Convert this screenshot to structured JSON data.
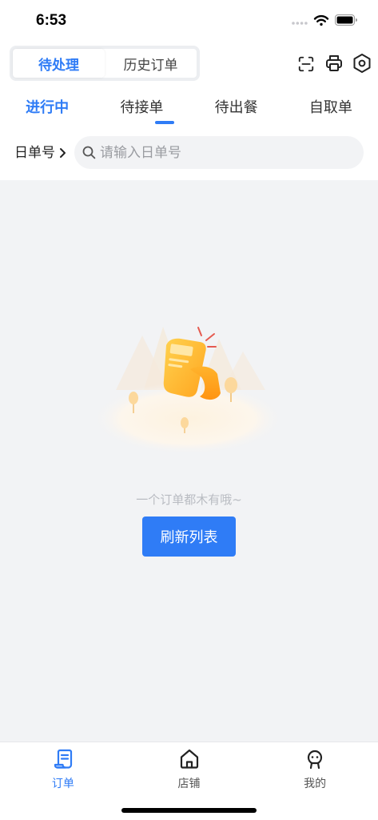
{
  "status_bar": {
    "time": "6:53"
  },
  "header": {
    "segments": [
      {
        "label": "待处理",
        "active": true
      },
      {
        "label": "历史订单",
        "active": false
      }
    ],
    "actions": [
      {
        "icon": "scan-icon"
      },
      {
        "icon": "printer-icon"
      },
      {
        "icon": "settings-icon"
      }
    ]
  },
  "tabs": [
    {
      "label": "进行中",
      "active": true
    },
    {
      "label": "待接单",
      "active": false
    },
    {
      "label": "待出餐",
      "active": false
    },
    {
      "label": "自取单",
      "active": false
    }
  ],
  "filter": {
    "field_label": "日单号",
    "search_placeholder": "请输入日单号",
    "search_value": ""
  },
  "empty_state": {
    "message": "一个订单都木有哦~",
    "refresh_button": "刷新列表"
  },
  "bottom_nav": [
    {
      "label": "订单",
      "icon": "order-icon",
      "active": true
    },
    {
      "label": "店铺",
      "icon": "store-icon",
      "active": false
    },
    {
      "label": "我的",
      "icon": "profile-icon",
      "active": false
    }
  ],
  "colors": {
    "accent": "#2f7cf6",
    "page_background": "#f2f3f5",
    "muted_text": "#b9bcc2"
  }
}
